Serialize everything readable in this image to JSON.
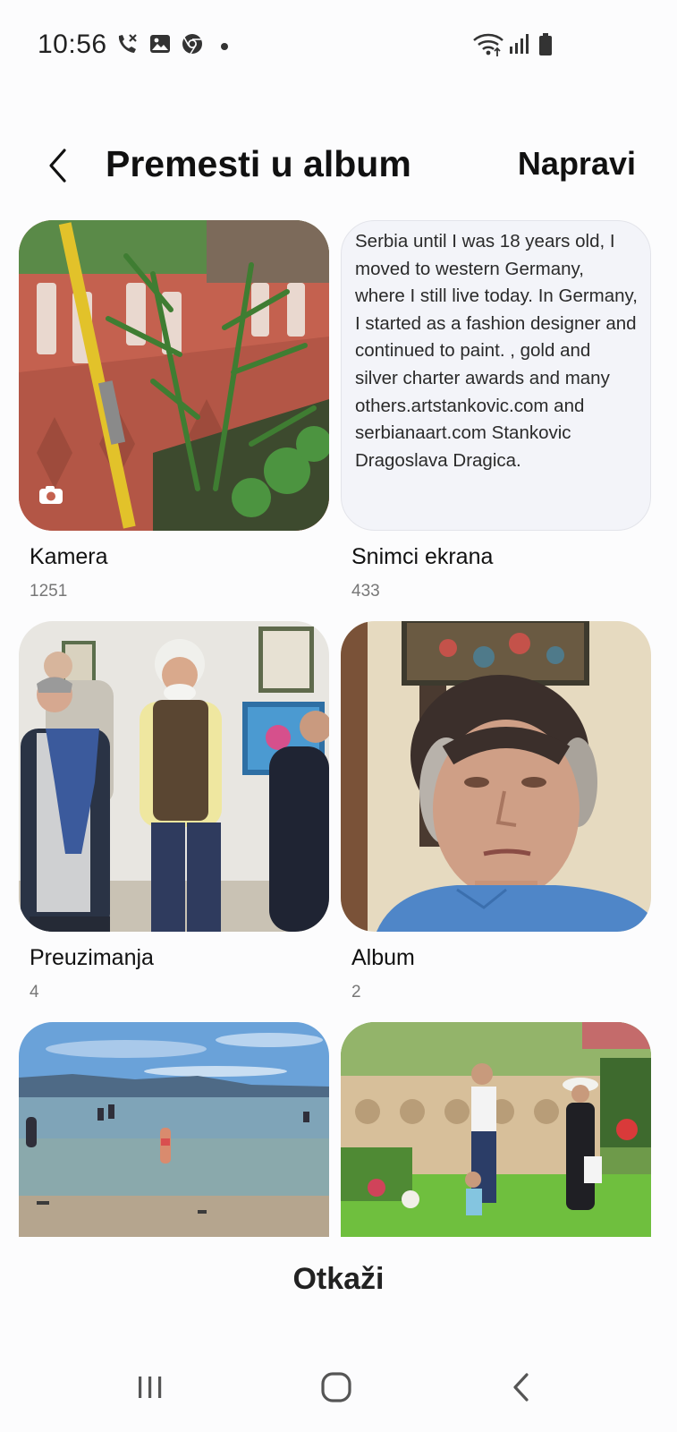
{
  "status_bar": {
    "time": "10:56",
    "left_icons": [
      "call-missed-icon",
      "gallery-icon",
      "chrome-icon",
      "dot-icon"
    ],
    "right_icons": [
      "wifi-icon",
      "signal-icon",
      "battery-icon"
    ]
  },
  "header": {
    "title": "Premesti u album",
    "create_label": "Napravi"
  },
  "albums": [
    {
      "name": "Kamera",
      "count": "1251"
    },
    {
      "name": "Snimci ekrana",
      "count": "433",
      "preview_text": "Serbia until I was 18 years old, I moved to western Germany, where I still live today. In Germany, I started as a fashion designer and continued to paint. , gold and silver charter awards and many others.artstankovic.com and serbianaart.com Stankovic Dragoslava Dragica."
    },
    {
      "name": "Preuzimanja",
      "count": "4"
    },
    {
      "name": "Album",
      "count": "2"
    },
    {
      "name": "",
      "count": ""
    },
    {
      "name": "",
      "count": ""
    }
  ],
  "footer": {
    "cancel_label": "Otkaži"
  },
  "nav_bar": {
    "buttons": [
      "recent-apps-icon",
      "home-icon",
      "back-icon"
    ]
  },
  "colors": {
    "background": "#fcfcfd",
    "text": "#111111",
    "count_text": "#777777"
  }
}
